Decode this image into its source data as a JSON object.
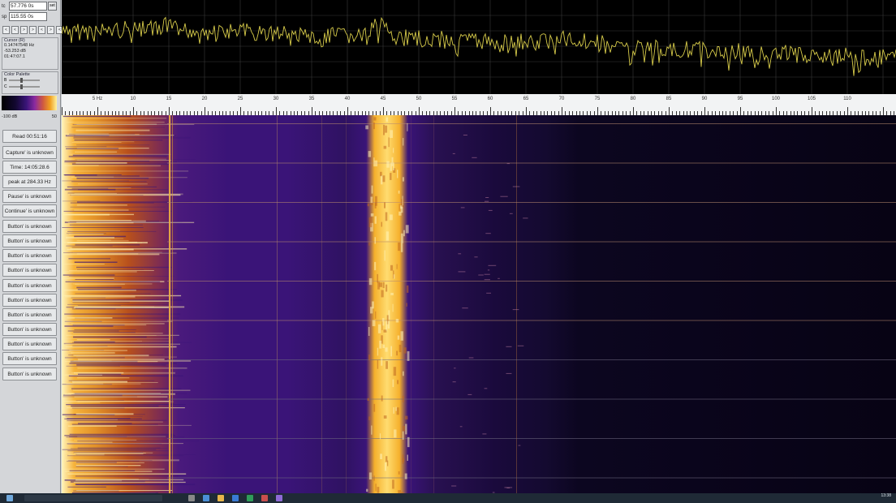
{
  "panel": {
    "field_t": {
      "label": "tc",
      "value": "57.776 0s",
      "btn": "set"
    },
    "field_sp": {
      "label": "sp",
      "value": "115.55 0s"
    },
    "spin_glyphs": [
      "<",
      "<",
      ">",
      ">",
      "<",
      ">",
      "<",
      ">"
    ],
    "cursor": {
      "title": "Cursor (R)",
      "lines": [
        "0.14747548 Hz",
        "-53.253 dB",
        "01:47:07.1"
      ]
    },
    "palette": {
      "title": "Color Palette",
      "b_label": "B",
      "c_label": "C"
    },
    "gradient_min": "-100 dB",
    "gradient_max": "50",
    "buttons": [
      "Read 00:51:16",
      "Capture' is unknown",
      "Time: 14:05:28.6",
      "peak at 284.33 Hz",
      "Pause' is unknown",
      "Continue' is unknown",
      "Button' is unknown",
      "Button' is unknown",
      "Button' is unknown",
      "Button' is unknown",
      "Button' is unknown",
      "Button' is unknown",
      "Button' is unknown",
      "Button' is unknown",
      "Button' is unknown",
      "Button' is unknown",
      "Button' is unknown"
    ]
  },
  "spectrum": {
    "trace_color": "#d8cc4a",
    "background": "#000000"
  },
  "ruler": {
    "labels": [
      "5 Hz",
      "10",
      "15",
      "20",
      "25",
      "30",
      "35",
      "40",
      "45",
      "50",
      "55",
      "60",
      "65",
      "70",
      "75",
      "80",
      "85",
      "90",
      "95",
      "100",
      "105",
      "110"
    ]
  },
  "waterfall": {
    "palette": [
      "#070314",
      "#3a1478",
      "#b8501c",
      "#f5b02c",
      "#fff6c0"
    ]
  },
  "taskbar": {
    "clock_time": "13:38",
    "clock_date": "..."
  }
}
